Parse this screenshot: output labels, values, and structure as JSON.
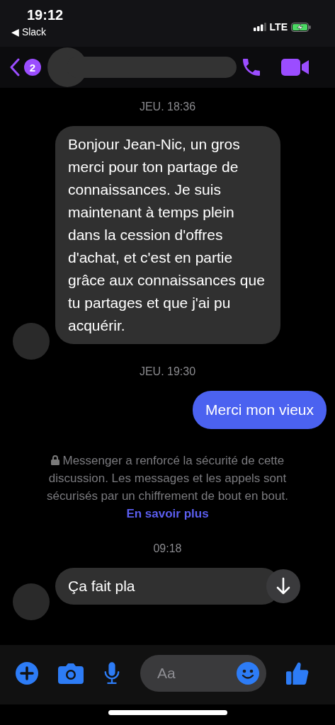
{
  "status_bar": {
    "time": "19:12",
    "back_app": "◀ Slack",
    "network": "LTE",
    "charging": true
  },
  "header": {
    "unread_count": "2",
    "name_hidden": true
  },
  "messages": [
    {
      "kind": "timestamp",
      "text": "JEU. 18:36"
    },
    {
      "kind": "incoming",
      "text": "Bonjour Jean-Nic, un gros merci pour ton partage de connaissances. Je suis maintenant à temps plein dans la cession d'offres d'achat, et c'est en partie grâce aux connaissances que tu partages et que j'ai pu acquérir.",
      "avatar_hidden": true
    },
    {
      "kind": "timestamp",
      "text": "JEU. 19:30"
    },
    {
      "kind": "outgoing",
      "text": "Merci mon vieux"
    },
    {
      "kind": "notice",
      "text": "Messenger a renforcé la sécurité de cette discussion. Les messages et les appels sont sécurisés par un chiffrement de bout en bout.",
      "link": "En savoir plus"
    },
    {
      "kind": "timestamp",
      "text": "09:18"
    },
    {
      "kind": "incoming",
      "text": "Ça fait pla",
      "avatar_hidden": true,
      "scroll_down": true
    }
  ],
  "composer": {
    "placeholder": "Aa"
  }
}
